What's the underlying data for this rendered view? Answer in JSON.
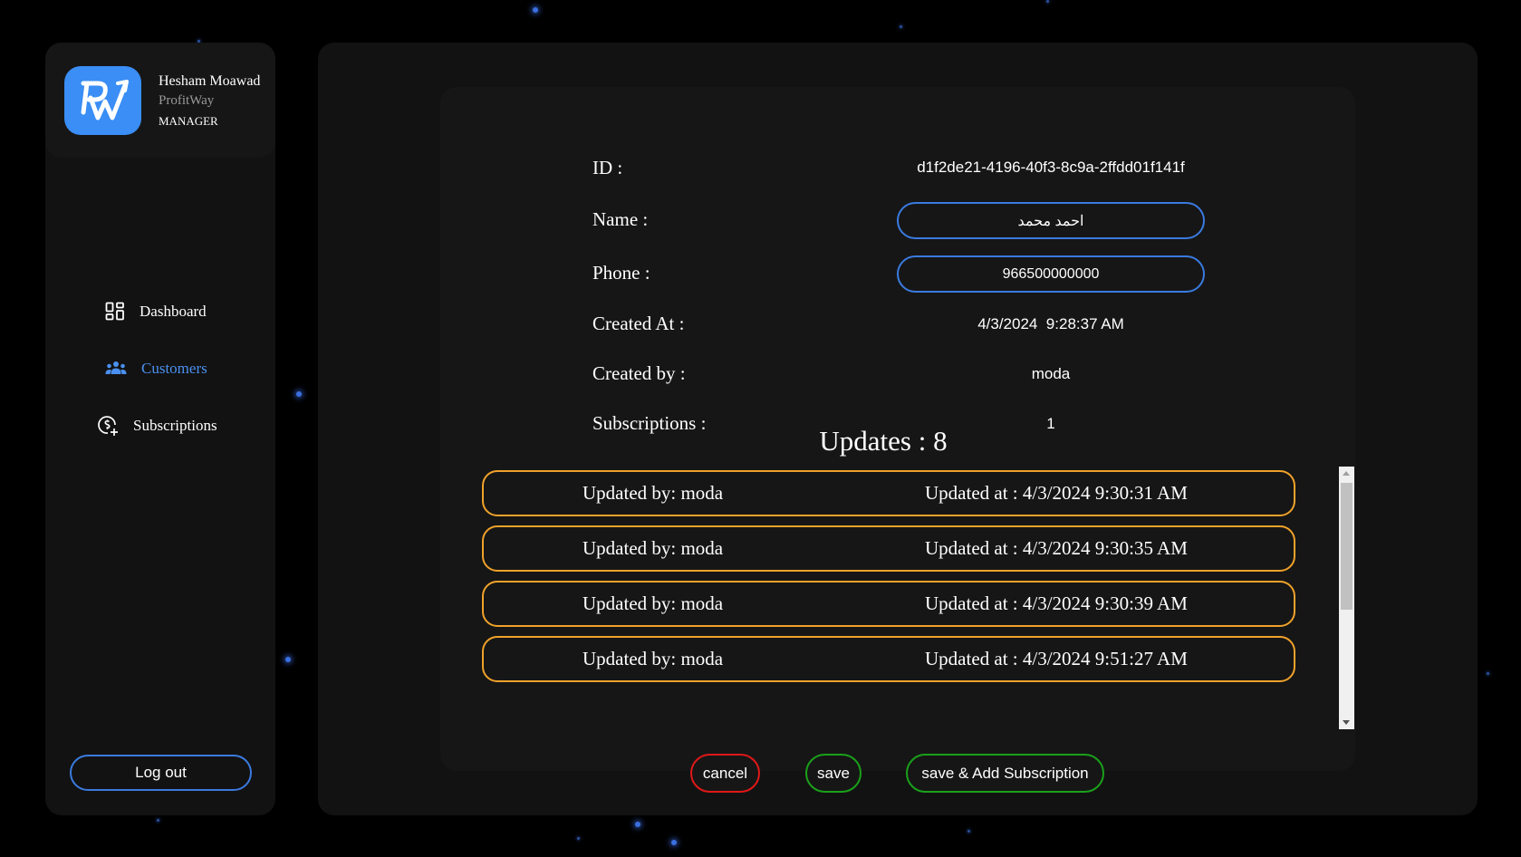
{
  "sidebar": {
    "profile": {
      "name": "Hesham Moawad",
      "company": "ProfitWay",
      "role": "MANAGER",
      "logo_icon": "profitway-logo-icon"
    },
    "nav": [
      {
        "label": "Dashboard",
        "icon": "dashboard-grid-icon",
        "active": false
      },
      {
        "label": "Customers",
        "icon": "users-group-icon",
        "active": true
      },
      {
        "label": "Subscriptions",
        "icon": "dollar-plus-icon",
        "active": false
      }
    ],
    "logout_label": "Log out"
  },
  "customer": {
    "fields": [
      {
        "label": "ID :",
        "value": "d1f2de21-4196-40f3-8c9a-2ffdd01f141f"
      },
      {
        "label": "Name :",
        "value": "احمد محمد"
      },
      {
        "label": "Phone :",
        "value": "966500000000"
      },
      {
        "label": "Created At :",
        "value": "4/3/2024  9:28:37 AM"
      },
      {
        "label": "Created by :",
        "value": "moda"
      },
      {
        "label": "Subscriptions :",
        "value": "1"
      }
    ]
  },
  "updates": {
    "title": "Updates : 8",
    "rows": [
      {
        "by": "Updated by: moda",
        "at": "Updated at : 4/3/2024 9:30:31 AM"
      },
      {
        "by": "Updated by: moda",
        "at": "Updated at : 4/3/2024 9:30:35 AM"
      },
      {
        "by": "Updated by: moda",
        "at": "Updated at : 4/3/2024 9:30:39 AM"
      },
      {
        "by": "Updated by: moda",
        "at": "Updated at : 4/3/2024 9:51:27 AM"
      }
    ]
  },
  "actions": {
    "cancel_label": "cancel",
    "save_label": "save",
    "save_add_label": "save & Add Subscription"
  },
  "colors": {
    "accent_blue": "#3a7be0",
    "update_border": "#f0a22a",
    "cancel_border": "#e01818",
    "save_border": "#1aa01a"
  }
}
